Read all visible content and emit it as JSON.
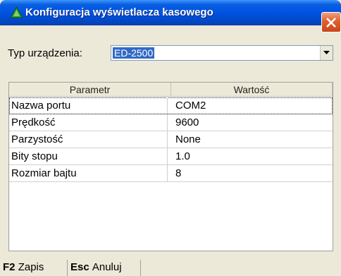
{
  "window": {
    "title": "Konfiguracja wyświetlacza kasowego"
  },
  "device": {
    "label": "Typ urządzenia:",
    "selected": "ED-2500"
  },
  "grid": {
    "headers": [
      "Parametr",
      "Wartość"
    ],
    "rows": [
      {
        "param": "Nazwa portu",
        "value": "COM2"
      },
      {
        "param": "Prędkość",
        "value": "9600"
      },
      {
        "param": "Parzystość",
        "value": "None"
      },
      {
        "param": "Bity stopu",
        "value": "1.0"
      },
      {
        "param": "Rozmiar bajtu",
        "value": "8"
      }
    ]
  },
  "footer": {
    "save_key": "F2",
    "save_label": "Zapis",
    "cancel_key": "Esc",
    "cancel_label": "Anuluj"
  },
  "colors": {
    "titlebar": "#0054e3",
    "selection": "#316ac5",
    "close": "#e0602c",
    "window_bg": "#ece9d8"
  }
}
